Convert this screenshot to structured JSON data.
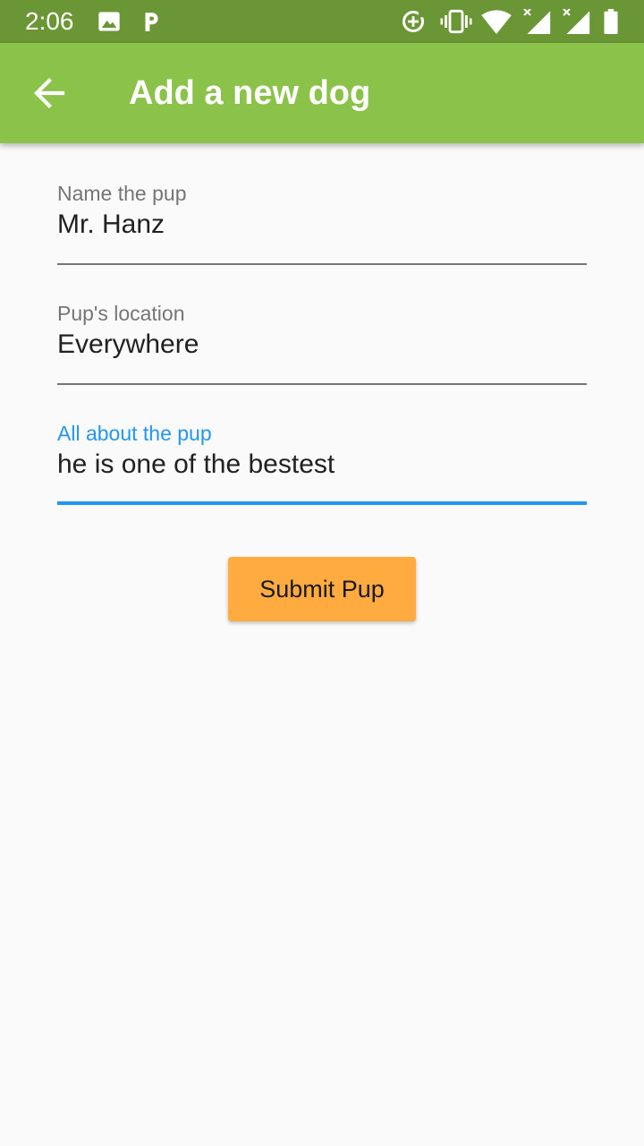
{
  "status_bar": {
    "time": "2:06",
    "icons": [
      "image-icon",
      "parking-icon",
      "data-saver-icon",
      "vibrate-icon",
      "wifi-icon",
      "signal-no-data-icon",
      "signal-no-data-icon",
      "battery-icon"
    ]
  },
  "app_bar": {
    "title": "Add a new dog",
    "back_icon": "arrow-back-icon",
    "color": "#8bc34a"
  },
  "form": {
    "name": {
      "label": "Name the pup",
      "value": "Mr. Hanz"
    },
    "location": {
      "label": "Pup's location",
      "value": "Everywhere"
    },
    "description": {
      "label": "All about the pup",
      "value": "he is one of the bestest",
      "focused": true
    }
  },
  "submit_button": {
    "label": "Submit Pup",
    "color": "#ffab40"
  },
  "colors": {
    "status_bar": "#6a9636",
    "focus": "#2196f3",
    "background": "#fafafa"
  }
}
